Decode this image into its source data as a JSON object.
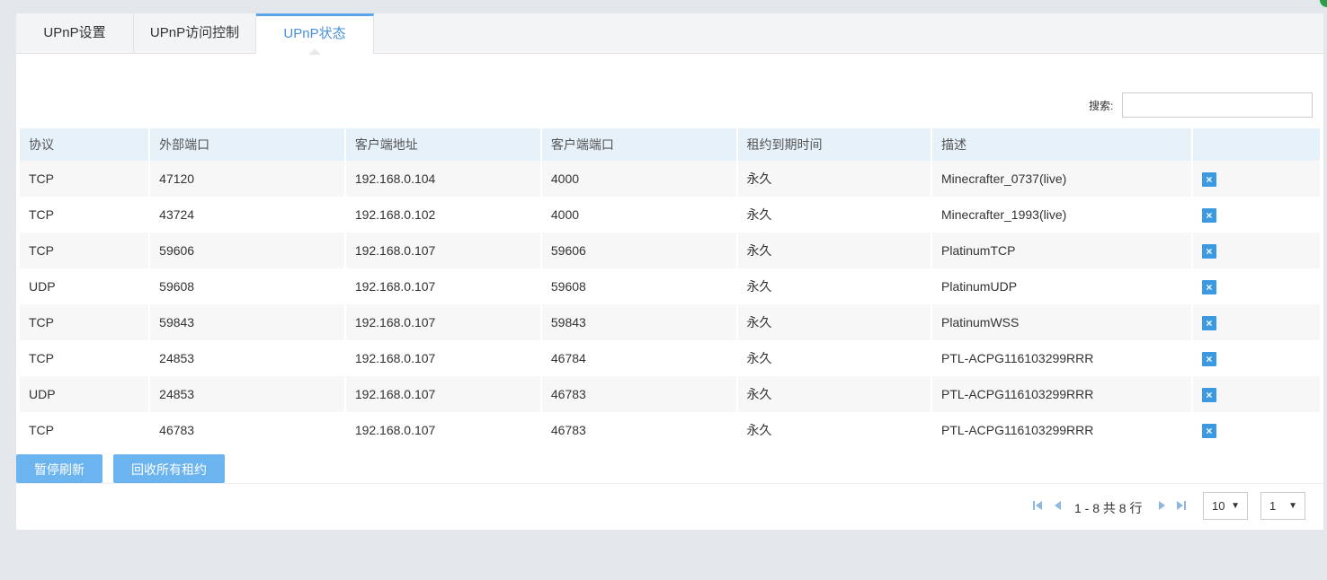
{
  "tabs": [
    {
      "label": "UPnP设置"
    },
    {
      "label": "UPnP访问控制"
    },
    {
      "label": "UPnP状态"
    }
  ],
  "search": {
    "label": "搜索:",
    "value": "",
    "placeholder": ""
  },
  "table": {
    "headers": [
      "协议",
      "外部端口",
      "客户端地址",
      "客户端端口",
      "租约到期时间",
      "描述",
      ""
    ],
    "rows": [
      [
        "TCP",
        "47120",
        "192.168.0.104",
        "4000",
        "永久",
        "Minecrafter_0737(live)"
      ],
      [
        "TCP",
        "43724",
        "192.168.0.102",
        "4000",
        "永久",
        "Minecrafter_1993(live)"
      ],
      [
        "TCP",
        "59606",
        "192.168.0.107",
        "59606",
        "永久",
        "PlatinumTCP"
      ],
      [
        "UDP",
        "59608",
        "192.168.0.107",
        "59608",
        "永久",
        "PlatinumUDP"
      ],
      [
        "TCP",
        "59843",
        "192.168.0.107",
        "59843",
        "永久",
        "PlatinumWSS"
      ],
      [
        "TCP",
        "24853",
        "192.168.0.107",
        "46784",
        "永久",
        "PTL-ACPG116103299RRR"
      ],
      [
        "UDP",
        "24853",
        "192.168.0.107",
        "46783",
        "永久",
        "PTL-ACPG116103299RRR"
      ],
      [
        "TCP",
        "46783",
        "192.168.0.107",
        "46783",
        "永久",
        "PTL-ACPG116103299RRR"
      ]
    ],
    "delete_glyph": "×"
  },
  "actions": {
    "pause_label": "暂停刷新",
    "recycle_label": "回收所有租约"
  },
  "pagination": {
    "summary": "1 - 8 共 8 行",
    "page_size": "10",
    "page": "1"
  },
  "colors": {
    "accent": "#4a90d9",
    "button": "#6cb4ef",
    "delete": "#3b9ae1",
    "header_bg": "#e6f1fa"
  }
}
